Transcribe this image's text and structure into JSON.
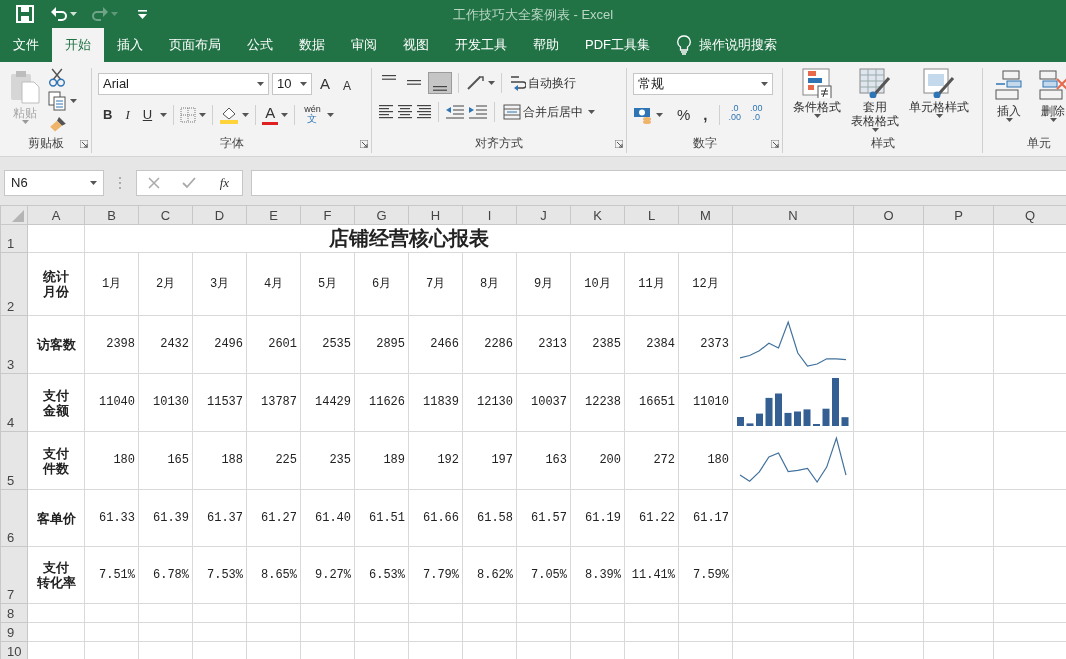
{
  "window": {
    "title": "工作技巧大全案例表  -  Excel"
  },
  "quick_access": {
    "redo_disabled": true
  },
  "tabs": [
    {
      "label": "文件",
      "selected": false
    },
    {
      "label": "开始",
      "selected": true
    },
    {
      "label": "插入",
      "selected": false
    },
    {
      "label": "页面布局",
      "selected": false
    },
    {
      "label": "公式",
      "selected": false
    },
    {
      "label": "数据",
      "selected": false
    },
    {
      "label": "审阅",
      "selected": false
    },
    {
      "label": "视图",
      "selected": false
    },
    {
      "label": "开发工具",
      "selected": false
    },
    {
      "label": "帮助",
      "selected": false
    },
    {
      "label": "PDF工具集",
      "selected": false
    }
  ],
  "tell_me": {
    "label": "操作说明搜索"
  },
  "ribbon": {
    "clipboard": {
      "label": "剪贴板",
      "paste": "粘贴",
      "paste_disabled": true
    },
    "font": {
      "label": "字体",
      "font_name": "Arial",
      "font_size": "10",
      "grow": "A",
      "shrink": "A",
      "bold": "B",
      "italic": "I",
      "underline": "U",
      "font_color": "A",
      "phonetic_top": "wén",
      "phonetic_bottom": "文"
    },
    "alignment": {
      "label": "对齐方式",
      "vertical_align": [
        {
          "selected": false
        },
        {
          "selected": false
        },
        {
          "selected": true
        }
      ],
      "wrap_text": "自动换行",
      "merge_center": "合并后居中"
    },
    "number": {
      "label": "数字",
      "format": "常规",
      "percent": "%",
      "comma": ",",
      "decimals": [
        {
          "top": ".0",
          "bottom": ".00"
        },
        {
          "top": ".00",
          "bottom": ".0"
        }
      ]
    },
    "styles": {
      "label": "样式",
      "buttons": [
        {
          "label": [
            "条件格式"
          ]
        },
        {
          "label": [
            "套用",
            "表格格式"
          ]
        },
        {
          "label": [
            "单元格样式"
          ]
        }
      ]
    },
    "cells": {
      "label": "单元",
      "buttons": [
        {
          "label": "插入"
        },
        {
          "label": "删除"
        }
      ]
    }
  },
  "formula_bar": {
    "name_box": "N6",
    "function_label": "fx"
  },
  "sheet": {
    "columns": [
      "A",
      "B",
      "C",
      "D",
      "E",
      "F",
      "G",
      "H",
      "I",
      "J",
      "K",
      "L",
      "M",
      "N",
      "O",
      "P",
      "Q"
    ],
    "row_numbers": [
      "1",
      "2",
      "3",
      "4",
      "5",
      "6",
      "7",
      "8",
      "9",
      "10"
    ],
    "title": "店铺经营核心报表",
    "data_rows": [
      {
        "label": [
          "统计",
          "月份"
        ],
        "kind": "header",
        "values": [
          "1月",
          "2月",
          "3月",
          "4月",
          "5月",
          "6月",
          "7月",
          "8月",
          "9月",
          "10月",
          "11月",
          "12月"
        ]
      },
      {
        "label": [
          "访客数"
        ],
        "kind": "metric",
        "sparkline": {
          "kind": "line"
        },
        "values": [
          "2398",
          "2432",
          "2496",
          "2601",
          "2535",
          "2895",
          "2466",
          "2286",
          "2313",
          "2385",
          "2384",
          "2373"
        ]
      },
      {
        "label": [
          "支付",
          "金额"
        ],
        "kind": "metric",
        "sparkline": {
          "kind": "column"
        },
        "values": [
          "11040",
          "10130",
          "11537",
          "13787",
          "14429",
          "11626",
          "11839",
          "12130",
          "10037",
          "12238",
          "16651",
          "11010"
        ]
      },
      {
        "label": [
          "支付",
          "件数"
        ],
        "kind": "metric",
        "sparkline": {
          "kind": "line"
        },
        "values": [
          "180",
          "165",
          "188",
          "225",
          "235",
          "189",
          "192",
          "197",
          "163",
          "200",
          "272",
          "180"
        ]
      },
      {
        "label": [
          "客单价"
        ],
        "kind": "metric",
        "values": [
          "61.33",
          "61.39",
          "61.37",
          "61.27",
          "61.40",
          "61.51",
          "61.66",
          "61.58",
          "61.57",
          "61.19",
          "61.22",
          "61.17"
        ]
      },
      {
        "label": [
          "支付",
          "转化率"
        ],
        "kind": "metric",
        "values": [
          "7.51%",
          "6.78%",
          "7.53%",
          "8.65%",
          "9.27%",
          "6.53%",
          "7.79%",
          "8.62%",
          "7.05%",
          "8.39%",
          "11.41%",
          "7.59%"
        ]
      }
    ]
  }
}
